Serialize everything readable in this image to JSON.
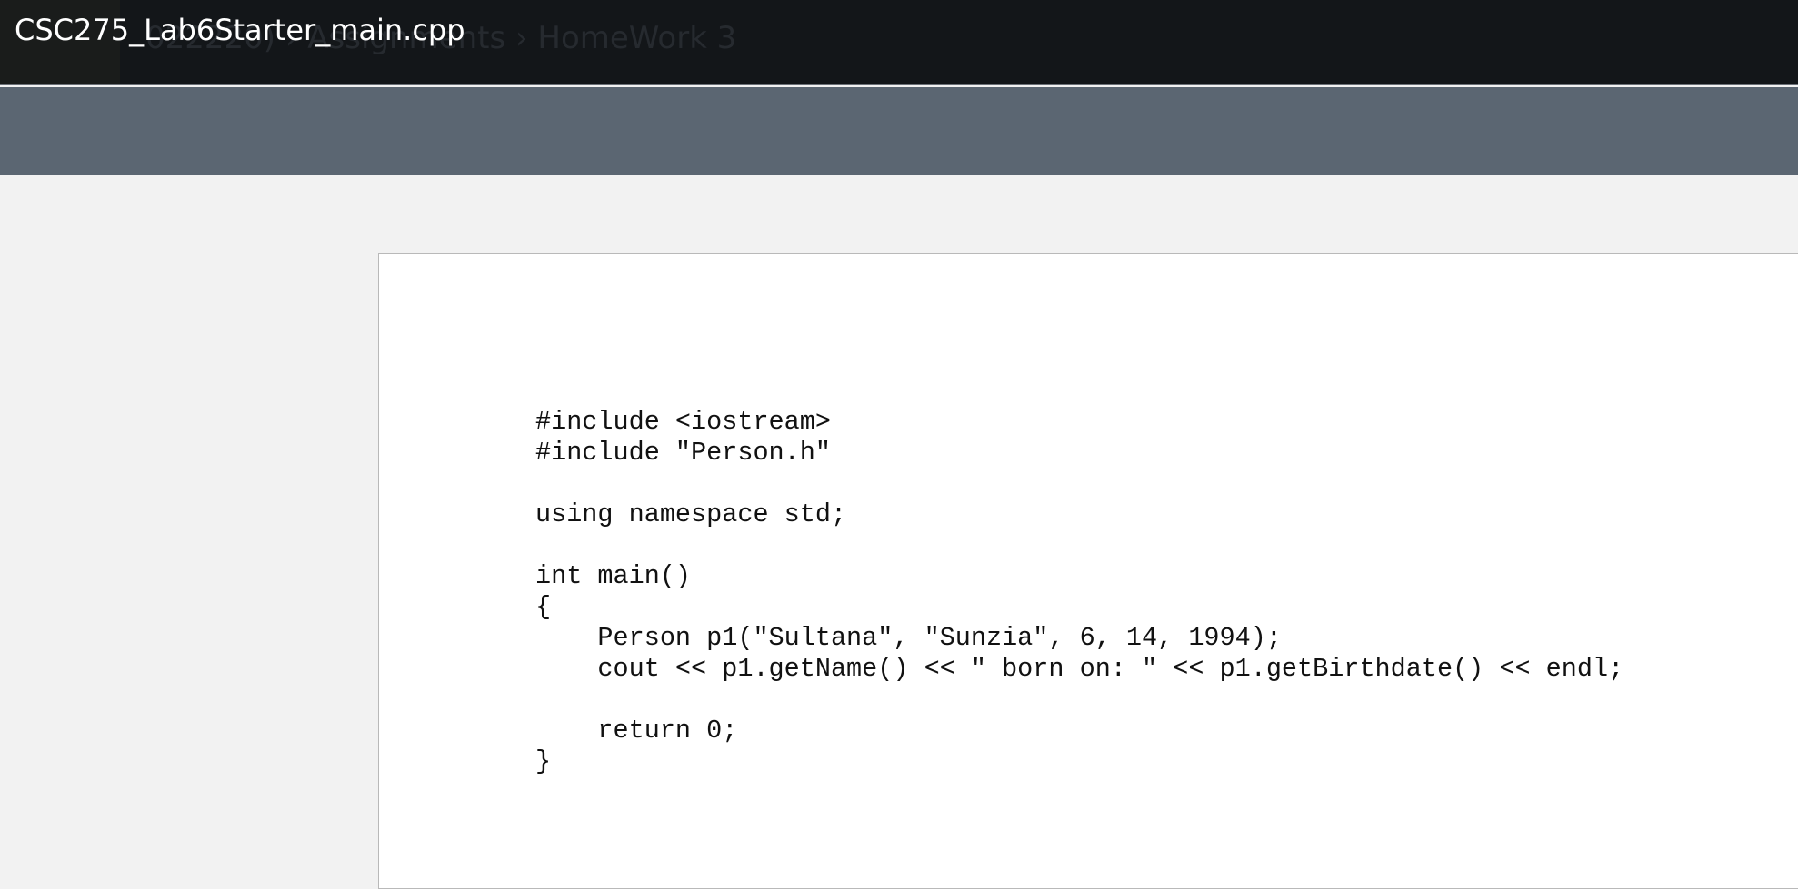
{
  "window": {
    "title": "CSC275_Lab6Starter_main.cpp",
    "breadcrumb_background": "022220) › Assignments › HomeWork 3"
  },
  "document": {
    "code_lines": [
      "#include <iostream>",
      "#include \"Person.h\"",
      "",
      "using namespace std;",
      "",
      "int main()",
      "{",
      "    Person p1(\"Sultana\", \"Sunzia\", 6, 14, 1994);",
      "    cout << p1.getName() << \" born on: \" << p1.getBirthdate() << endl;",
      "",
      "    return 0;",
      "}"
    ]
  },
  "colors": {
    "topbar": "#131619",
    "subbar": "#5b6672",
    "page_background": "#f2f2f2",
    "document_background": "#ffffff"
  }
}
